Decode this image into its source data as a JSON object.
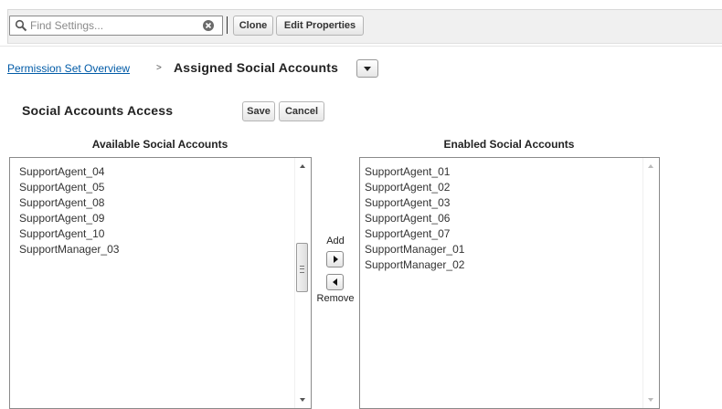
{
  "toolbar": {
    "search_placeholder": "Find Settings...",
    "clone_label": "Clone",
    "edit_properties_label": "Edit Properties"
  },
  "breadcrumb": {
    "parent_label": "Permission Set Overview",
    "separator": ">",
    "current_label": "Assigned Social Accounts"
  },
  "section": {
    "title": "Social Accounts Access",
    "save_label": "Save",
    "cancel_label": "Cancel"
  },
  "available": {
    "header": "Available Social Accounts",
    "items": [
      "SupportAgent_04",
      "SupportAgent_05",
      "SupportAgent_08",
      "SupportAgent_09",
      "SupportAgent_10",
      "SupportManager_03"
    ]
  },
  "enabled": {
    "header": "Enabled Social Accounts",
    "items": [
      "SupportAgent_01",
      "SupportAgent_02",
      "SupportAgent_03",
      "SupportAgent_06",
      "SupportAgent_07",
      "SupportManager_01",
      "SupportManager_02"
    ]
  },
  "transfer": {
    "add_label": "Add",
    "remove_label": "Remove"
  },
  "colors": {
    "link": "#015ba7",
    "toolbar_bg": "#f0f0f0"
  }
}
